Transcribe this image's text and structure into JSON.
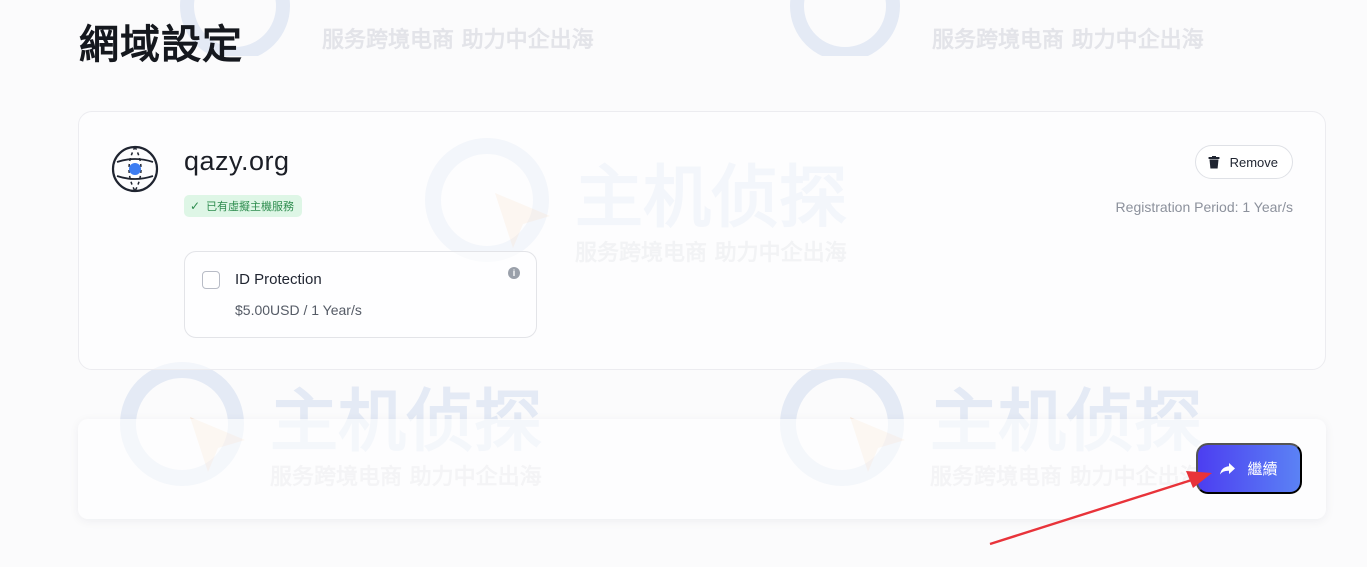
{
  "page": {
    "title": "網域設定"
  },
  "domain": {
    "name": "qazy.org",
    "hosting_badge": "已有虛擬主機服務",
    "remove_label": "Remove",
    "registration_period": "Registration Period: 1 Year/s"
  },
  "addon": {
    "name": "ID Protection",
    "price": "$5.00USD / 1 Year/s",
    "checked": false
  },
  "action": {
    "continue_label": "繼續"
  },
  "watermark": {
    "logo_text": "主机侦探",
    "tagline": "服务跨境电商  助力中企出海"
  },
  "colors": {
    "accent_start": "#4c3ef1",
    "accent_end": "#5b82f5",
    "badge_bg": "#def6e6",
    "badge_text": "#2e8d4f",
    "annotation_arrow": "#e8333a"
  },
  "icons": {
    "domain": "globe-icon",
    "remove": "trash-icon",
    "badge": "check-icon",
    "info": "info-icon",
    "continue": "share-arrow-icon"
  }
}
